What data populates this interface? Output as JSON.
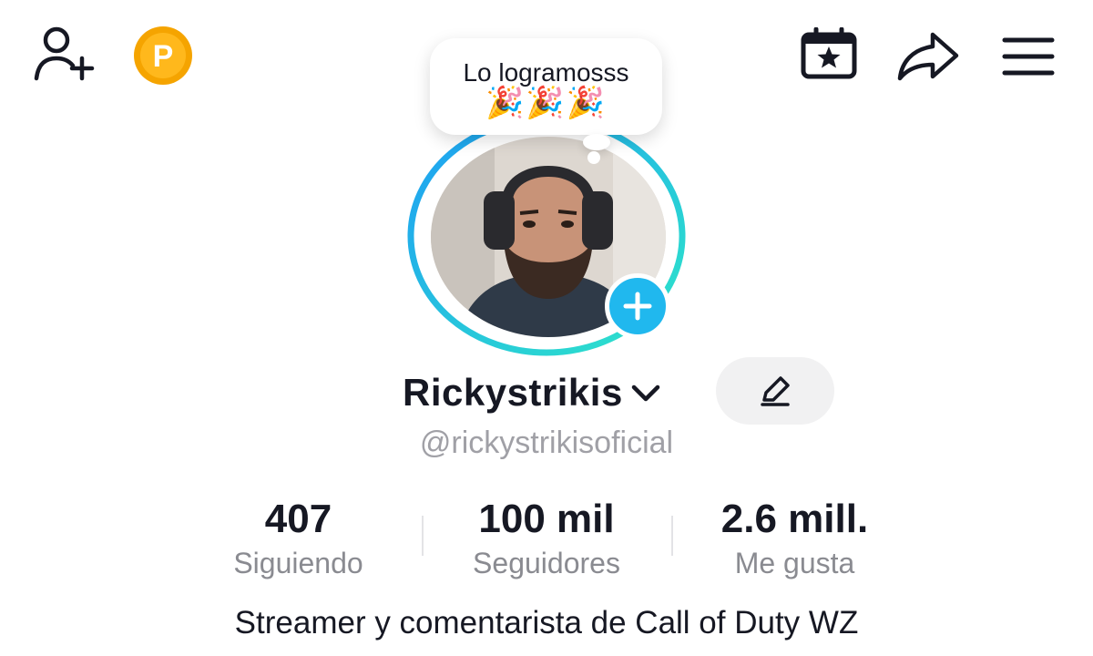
{
  "top_bar": {
    "icons": [
      "add-friend-icon",
      "coin-icon",
      "calendar-star-icon",
      "share-icon",
      "menu-icon"
    ],
    "coin_letter": "P",
    "coin_color": "#f5a400"
  },
  "profile": {
    "note": "Lo logramosss",
    "note_emoji": "🎉🎉🎉",
    "username": "Rickystrikis",
    "handle": "@rickystrikisoficial",
    "ring_colors": [
      "#1e9ef4",
      "#2ee6c8"
    ],
    "add_story_color": "#20b8ee"
  },
  "stats": [
    {
      "value": "407",
      "label": "Siguiendo"
    },
    {
      "value": "100 mil",
      "label": "Seguidores"
    },
    {
      "value": "2.6 mill.",
      "label": "Me gusta"
    }
  ],
  "bio": "Streamer y comentarista de Call of Duty WZ"
}
